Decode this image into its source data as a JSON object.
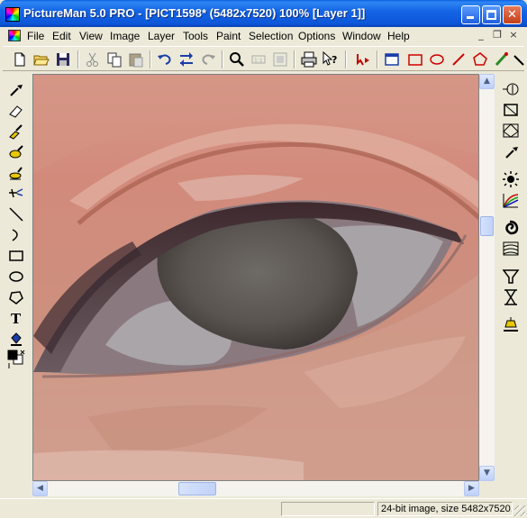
{
  "window": {
    "title": "PictureMan 5.0 PRO - [PICT1598* (5482x7520) 100% [Layer 1]]",
    "app_icon": "pictureman-app-icon",
    "title_bg": "#0a5fde",
    "controls": [
      {
        "name": "minimize-button",
        "icon": "minimize-icon"
      },
      {
        "name": "maximize-button",
        "icon": "maximize-icon"
      },
      {
        "name": "close-button",
        "icon": "close-icon",
        "glyph": "✕"
      }
    ]
  },
  "menu": {
    "doc_icon": "document-icon",
    "items": [
      "File",
      "Edit",
      "View",
      "Image",
      "Layer",
      "Tools",
      "Paint",
      "Selection",
      "Options",
      "Window",
      "Help"
    ],
    "mdi_controls": [
      "_",
      "❐",
      "×"
    ]
  },
  "toolbar": {
    "buttons": [
      "new-icon",
      "open-icon",
      "save-icon",
      "cut-icon",
      "copy-icon",
      "paste-icon",
      "undo-icon",
      "flip-icon",
      "redo-icon",
      "zoom-icon",
      "actual-size-icon",
      "fit-icon",
      "print-icon",
      "help-icon",
      "transform-arrow-icon",
      "window-icon",
      "rectangle-icon",
      "ellipse-icon",
      "line-icon",
      "polygon-icon",
      "brush-icon",
      "arrow-icon"
    ]
  },
  "left_tools": [
    "eyedropper-icon",
    "eraser-icon",
    "brush-icon",
    "smudge-icon",
    "stamp-icon",
    "spray-icon",
    "line-icon",
    "curve-icon",
    "rectangle-icon",
    "ellipse-icon",
    "lasso-icon",
    "text-icon",
    "bucket-icon",
    "color-swatch-icon"
  ],
  "right_tools": [
    "histogram-icon",
    "crop-icon",
    "perspective-icon",
    "eyedropper-icon",
    "brightness-icon",
    "curves-icon",
    "spiral-icon",
    "texture-icon",
    "funnel-icon",
    "hourglass-icon",
    "lamp-icon"
  ],
  "document": {
    "content": "eye-photo"
  },
  "status": {
    "left": "",
    "right": "24-bit image, size 5482x7520,"
  },
  "colors": {
    "chrome": "#ece9d8",
    "accent": "#0a5fde",
    "skin": "#d99c86"
  }
}
